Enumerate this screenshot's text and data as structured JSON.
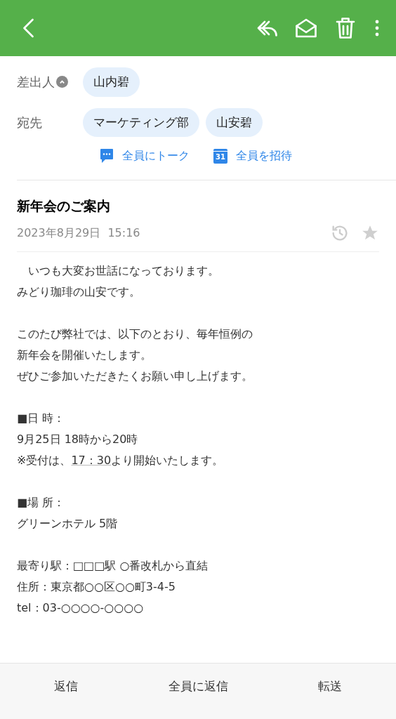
{
  "sender": {
    "label": "差出人",
    "name": "山内碧",
    "expanded": true
  },
  "recipients": {
    "label": "宛先",
    "names": [
      "マーケティング部",
      "山安碧"
    ]
  },
  "actions": [
    {
      "kind": "talk",
      "label": "全員にトーク"
    },
    {
      "kind": "invite",
      "label": "全員を招待",
      "icon_text": "31"
    }
  ],
  "subject": "新年会のご案内",
  "date": "2023年8月29日  15:16",
  "starred": false,
  "body": [
    [
      [
        {
          "text": "　いつも大変お世話になっております。"
        }
      ],
      [
        {
          "text": "みどり珈琲の山安です。"
        }
      ]
    ],
    [
      [
        {
          "text": "このたび弊社では、以下のとおり、毎年恒例の"
        }
      ],
      [
        {
          "text": "新年会を開催いたします。"
        }
      ],
      [
        {
          "text": "ぜひご参加いただきたくお願い申し上げます。"
        }
      ]
    ],
    [
      [
        {
          "text": "■日 時："
        }
      ],
      [
        {
          "text": "9月25日 18時から20時"
        }
      ],
      [
        {
          "text": "※受付は、"
        },
        {
          "text": "17：30",
          "kind": "link"
        },
        {
          "text": "より開始いたします。"
        }
      ]
    ],
    [
      [
        {
          "text": "■場 所："
        }
      ],
      [
        {
          "text": "グリーンホテル 5階"
        }
      ]
    ],
    [
      [
        {
          "text": "最寄り駅：□□□駅 ○番改札から直結"
        }
      ],
      [
        {
          "text": "住所：東京都○○区○○町3-4-5"
        }
      ],
      [
        {
          "text": "tel：03-○○○○-○○○○"
        }
      ]
    ]
  ],
  "footer": [
    "返信",
    "全員に返信",
    "転送"
  ]
}
